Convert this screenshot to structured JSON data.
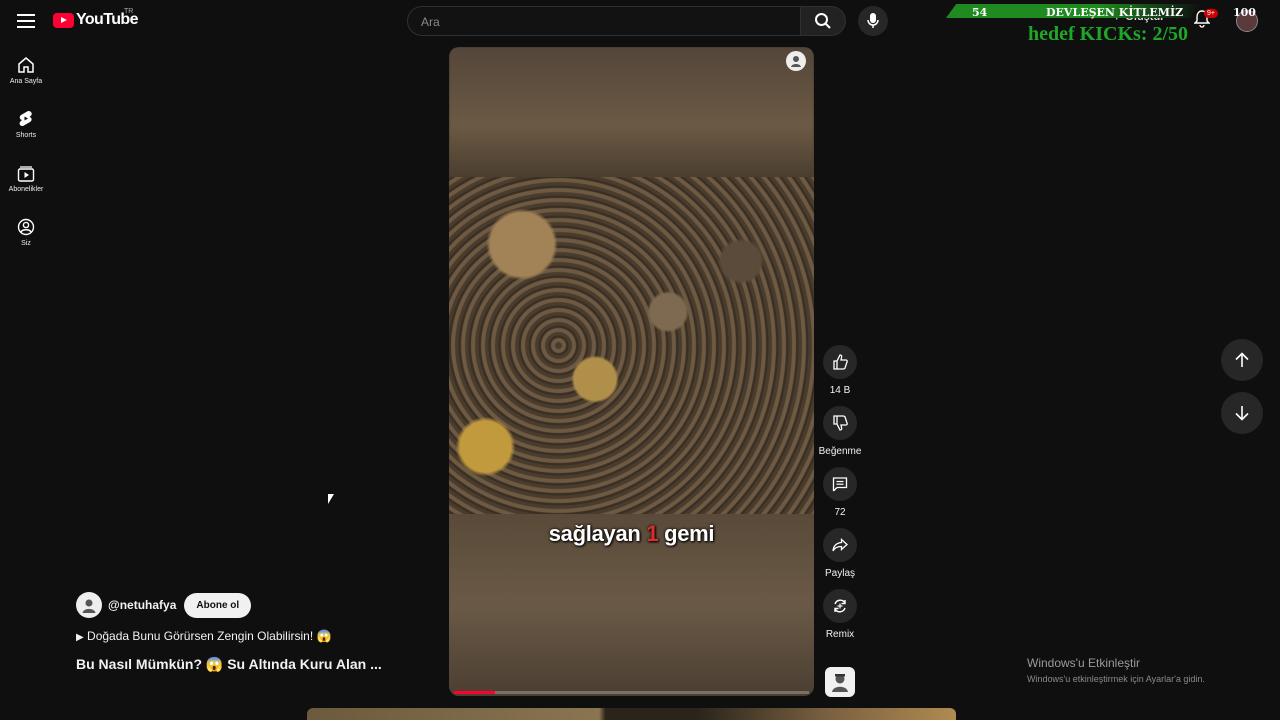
{
  "header": {
    "logo_text": "YouTube",
    "country_code": "TR",
    "search_placeholder": "Ara",
    "create_label": "Oluştur",
    "notifications_badge": "9+"
  },
  "overlay": {
    "left_value": "54",
    "title": "DEVLEŞEN KİTLEMİZ",
    "right_value": "100",
    "kicks": "hedef KICKs: 2/50",
    "bar_color": "#1f8a1f",
    "kicks_color": "#1fa827"
  },
  "sidebar": {
    "items": [
      {
        "label": "Ana Sayfa",
        "icon": "home-icon"
      },
      {
        "label": "Shorts",
        "icon": "shorts-icon"
      },
      {
        "label": "Abonelikler",
        "icon": "subscriptions-icon"
      },
      {
        "label": "Siz",
        "icon": "account-icon"
      }
    ]
  },
  "video": {
    "caption_before": "sağlayan ",
    "caption_highlight": "1",
    "caption_after": " gemi",
    "progress_fraction": 0.115
  },
  "actions": {
    "like_count": "14 B",
    "dislike_label": "Beğenme",
    "comment_count": "72",
    "share_label": "Paylaş",
    "remix_label": "Remix"
  },
  "channel": {
    "handle": "@netuhafya",
    "subscribe_label": "Abone ol",
    "playlist_text": "Doğada Bunu Görürsen Zengin Olabilirsin! 😱",
    "video_title": "Bu Nasıl Mümkün? 😱 Su Altında Kuru Alan ..."
  },
  "windows": {
    "activate_title": "Windows'u Etkinleştir",
    "activate_sub": "Windows'u etkinleştirmek için Ayarlar'a gidin."
  },
  "colors": {
    "background": "#0f0f0f",
    "brand_red": "#ff0033",
    "caption_highlight": "#e02b2b"
  }
}
